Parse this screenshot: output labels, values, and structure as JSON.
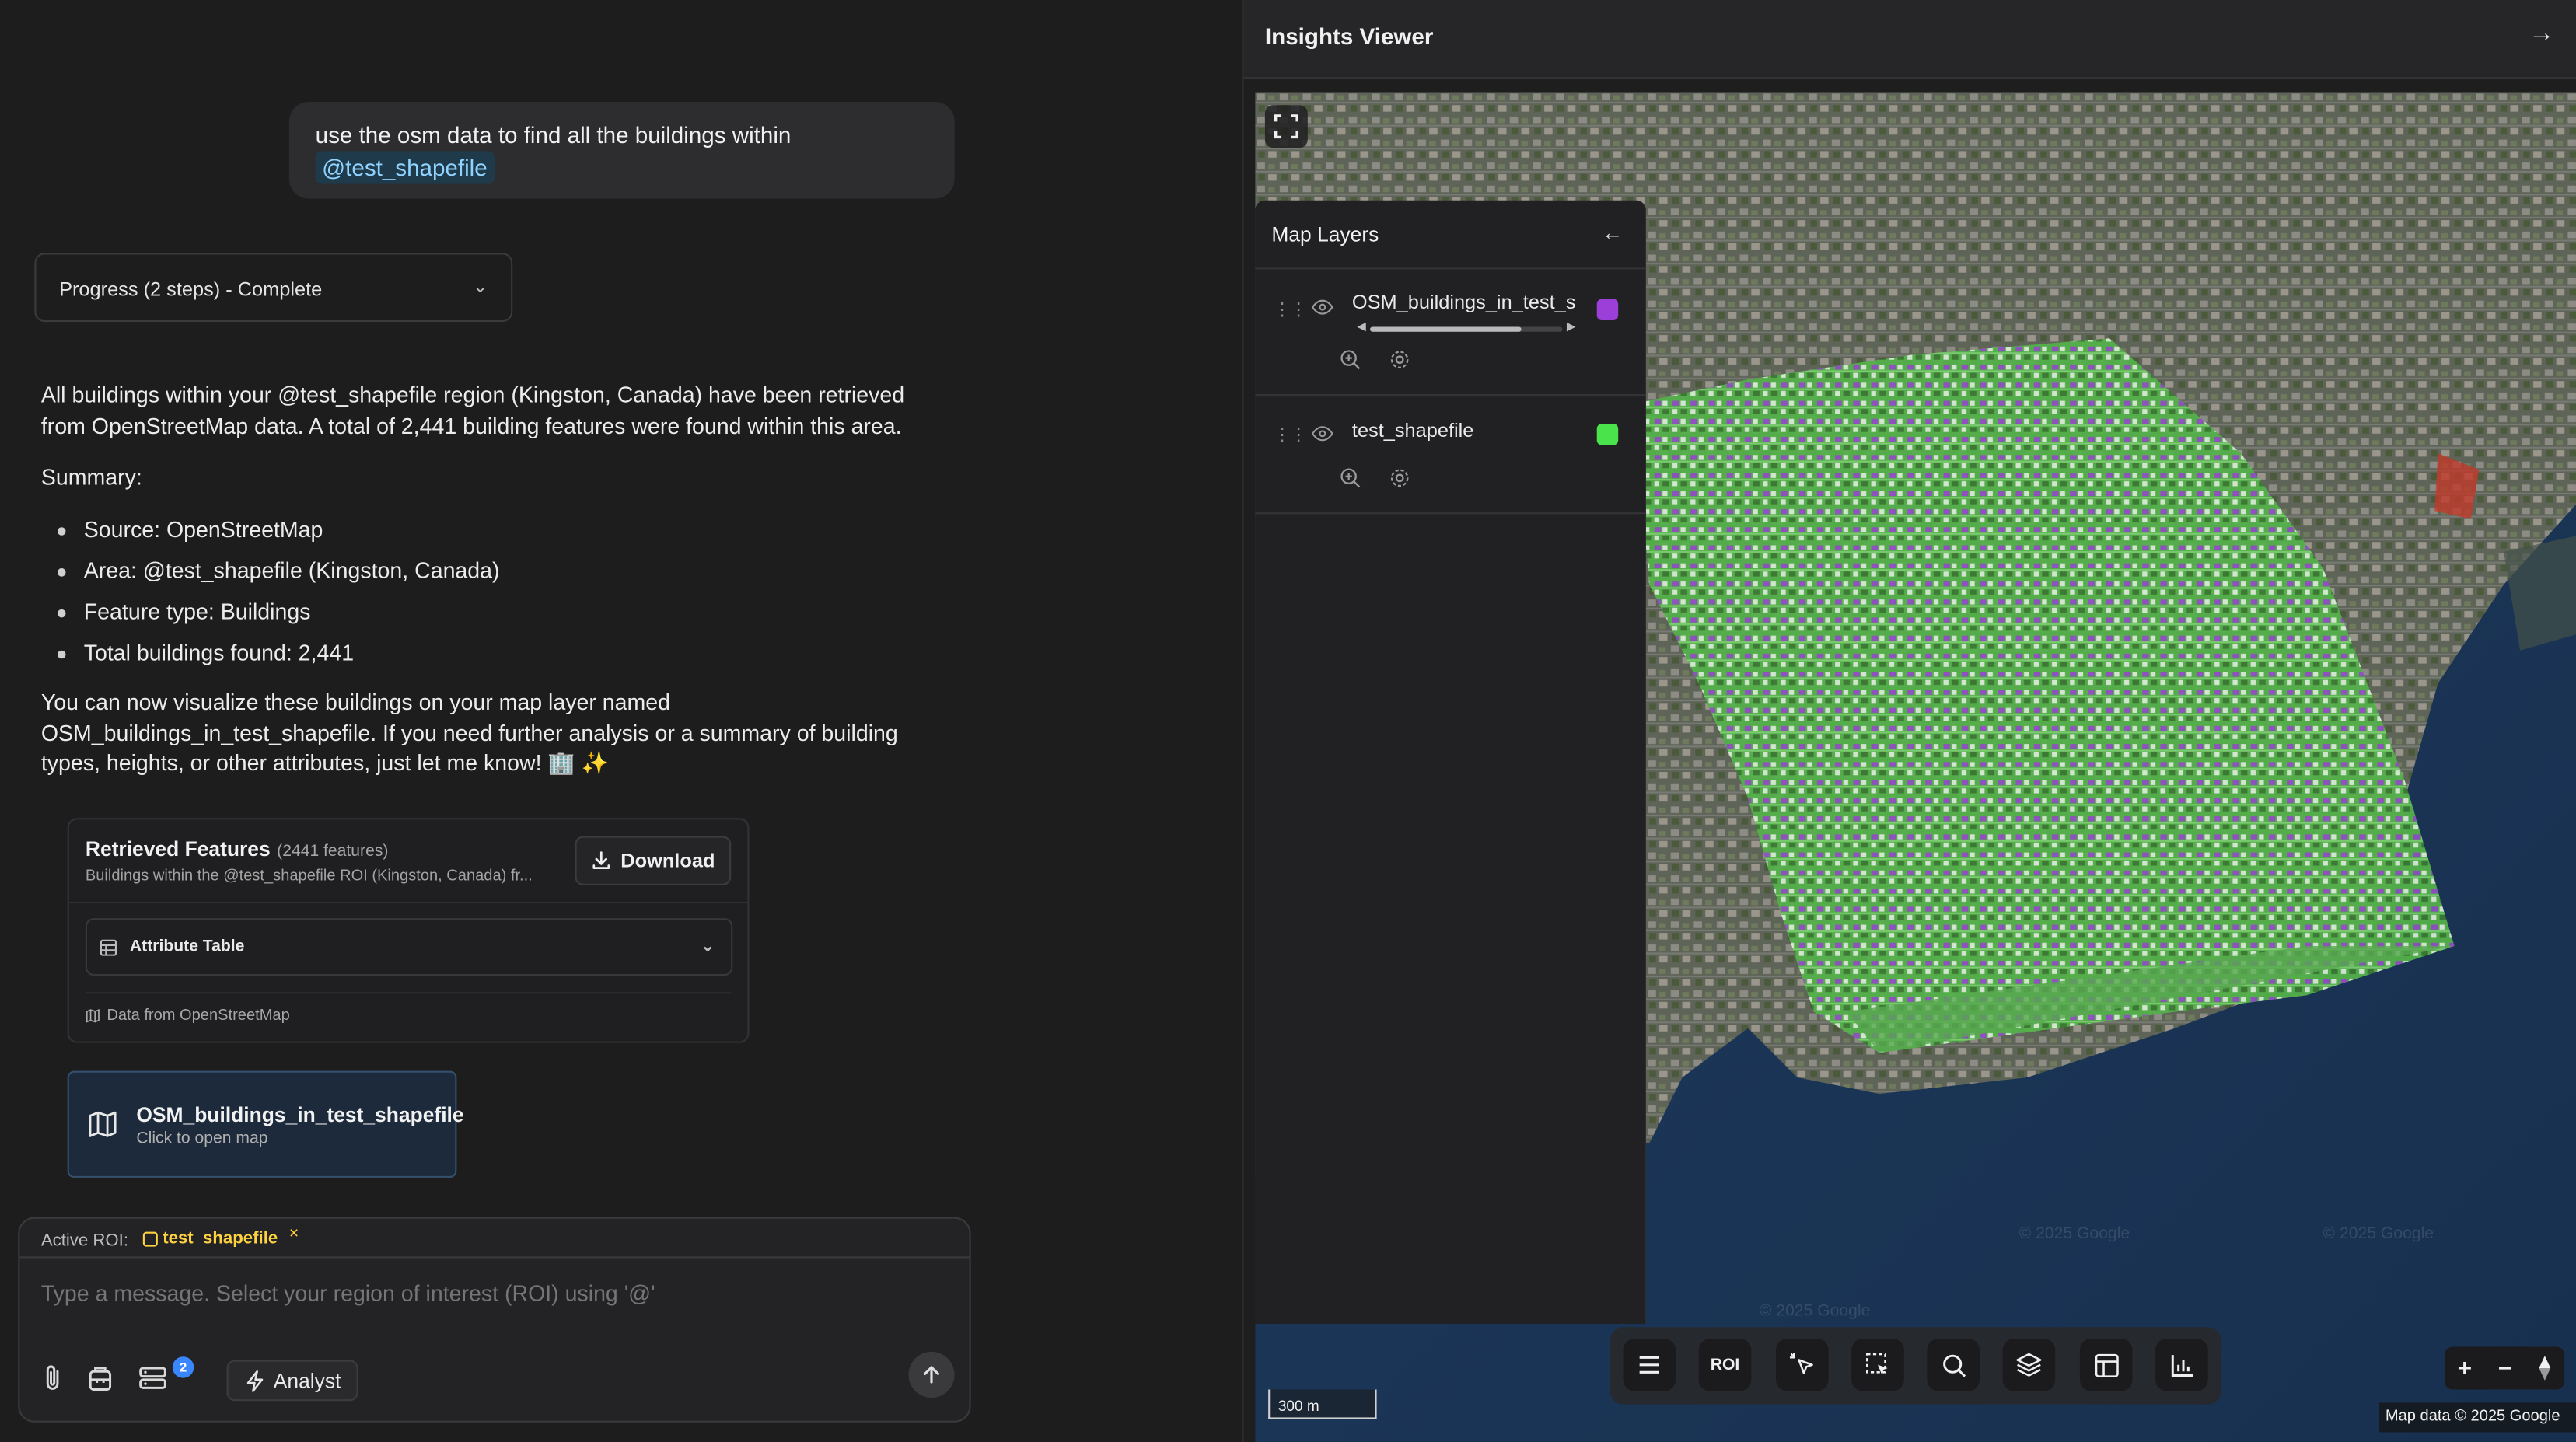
{
  "chat": {
    "user_message": "use the osm data to find all the buildings within",
    "user_mention": "@test_shapefile",
    "progress_label": "Progress (2 steps) - Complete",
    "answer_p1": "All buildings within your @test_shapefile region (Kingston, Canada) have been retrieved from OpenStreetMap data. A total of 2,441 building features were found within this area.",
    "summary_heading": "Summary:",
    "summary_items": [
      "Source: OpenStreetMap",
      "Area: @test_shapefile (Kingston, Canada)",
      "Feature type: Buildings",
      "Total buildings found: 2,441"
    ],
    "answer_p2": "You can now visualize these buildings on your map layer named OSM_buildings_in_test_shapefile. If you need further analysis or a summary of building types, heights, or other attributes, just let me know! 🏢 ✨",
    "features_card": {
      "title": "Retrieved Features",
      "count": "(2441 features)",
      "description": "Buildings within the @test_shapefile ROI (Kingston, Canada) fr...",
      "download_label": "Download",
      "attribute_table_label": "Attribute Table",
      "source_note": "Data from OpenStreetMap"
    },
    "map_link": {
      "title": "OSM_buildings_in_test_shapefile",
      "subtitle": "Click to open map"
    },
    "composer": {
      "active_roi_label": "Active ROI:",
      "roi_name": "test_shapefile",
      "roi_remove": "×",
      "placeholder": "Type a message. Select your region of interest (ROI) using '@'",
      "badge_count": "2",
      "mode_label": "Analyst"
    }
  },
  "viewer": {
    "title": "Insights Viewer",
    "close_glyph": "→",
    "layers_panel": {
      "title": "Map Layers",
      "back_glyph": "←",
      "layers": [
        {
          "name": "OSM_buildings_in_test_shapefile",
          "color": "#9b3fd8",
          "visible": true
        },
        {
          "name": "test_shapefile",
          "color": "#4be34b",
          "visible": true
        }
      ]
    },
    "toolbar": {
      "roi_label": "ROI",
      "tools": [
        "menu-icon",
        "roi-button",
        "pointer-icon",
        "box-select-icon",
        "search-icon",
        "layers-icon",
        "table-icon",
        "chart-icon"
      ]
    },
    "zoom": {
      "in": "+",
      "out": "−",
      "compass": "compass-icon"
    },
    "scale_label": "300 m",
    "attribution": "Map data © 2025 Google",
    "watermark": "© 2025 Google"
  },
  "colors": {
    "background": "#1d1d1e",
    "accent_blue": "#3a86ff",
    "roi_yellow": "#ffd23f",
    "buildings_purple": "#9b3fd8",
    "shapefile_green": "#4be34b"
  }
}
